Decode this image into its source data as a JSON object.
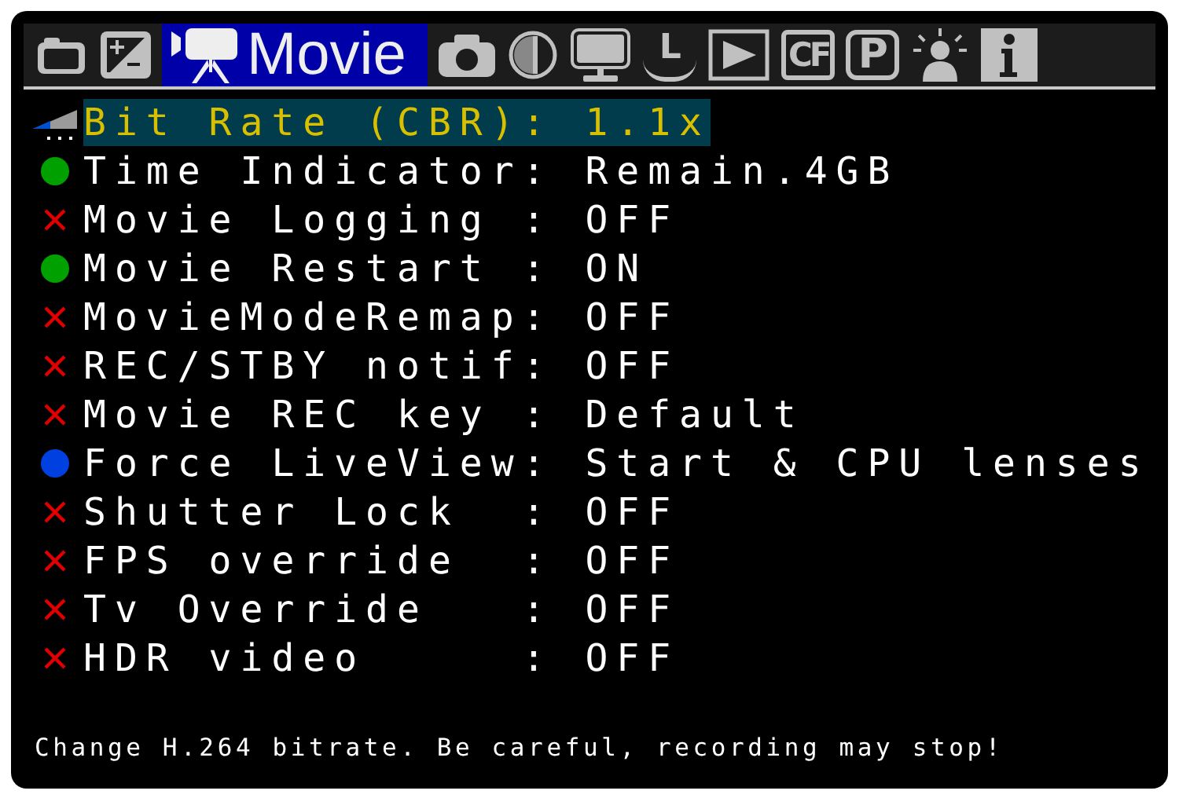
{
  "tabs": [
    {
      "kind": "camera",
      "selected": false
    },
    {
      "kind": "exposure",
      "selected": false
    },
    {
      "kind": "movie",
      "label": "Movie",
      "selected": true
    },
    {
      "kind": "shoot",
      "selected": false
    },
    {
      "kind": "contrast",
      "selected": false
    },
    {
      "kind": "display",
      "selected": false
    },
    {
      "kind": "face",
      "glyph": "L",
      "selected": false
    },
    {
      "kind": "play",
      "selected": false
    },
    {
      "kind": "card",
      "glyph": "CF",
      "selected": false
    },
    {
      "kind": "mode",
      "glyph": "P",
      "selected": false
    },
    {
      "kind": "light",
      "selected": false
    },
    {
      "kind": "info",
      "selected": false
    }
  ],
  "items": [
    {
      "kind": "level",
      "text": "Bit Rate (CBR): 1.1x",
      "selected": true
    },
    {
      "kind": "on",
      "text": "Time Indicator: Remain.4GB",
      "selected": false
    },
    {
      "kind": "off",
      "text": "Movie Logging : OFF",
      "selected": false
    },
    {
      "kind": "on",
      "text": "Movie Restart : ON",
      "selected": false
    },
    {
      "kind": "off",
      "text": "MovieModeRemap: OFF",
      "selected": false
    },
    {
      "kind": "off",
      "text": "REC/STBY notif: OFF",
      "selected": false
    },
    {
      "kind": "off",
      "text": "Movie REC key : Default",
      "selected": false
    },
    {
      "kind": "auto",
      "text": "Force LiveView: Start & CPU lenses",
      "selected": false
    },
    {
      "kind": "off",
      "text": "Shutter Lock  : OFF",
      "selected": false
    },
    {
      "kind": "off",
      "text": "FPS override  : OFF",
      "selected": false
    },
    {
      "kind": "off",
      "text": "Tv Override   : OFF",
      "selected": false
    },
    {
      "kind": "off",
      "text": "HDR video     : OFF",
      "selected": false
    }
  ],
  "help": "Change H.264 bitrate. Be careful, recording may stop!"
}
